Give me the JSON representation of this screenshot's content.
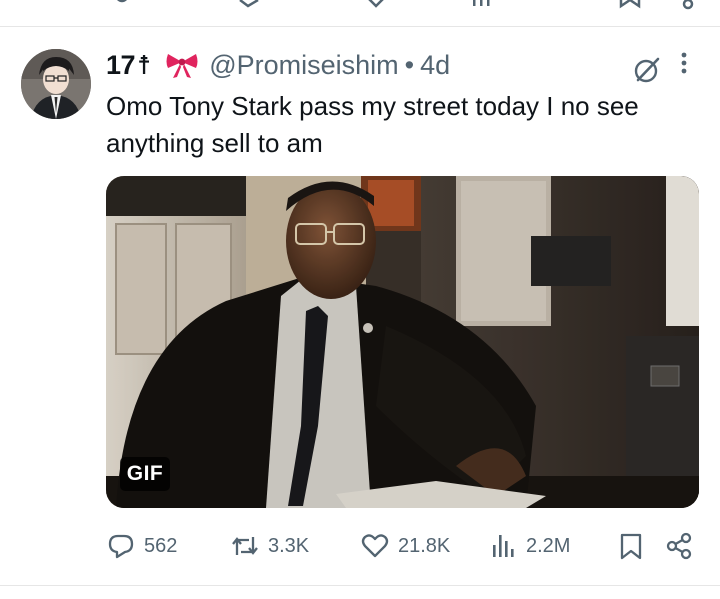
{
  "tweet": {
    "display_name": "17",
    "name_glyph": "☨",
    "handle": "@Promiseishim",
    "separator": "•",
    "time": "4d",
    "text": "Omo Tony Stark pass my street today I no see anything sell to am",
    "media": {
      "badge": "GIF"
    },
    "stats": {
      "replies": "562",
      "reposts": "3.3K",
      "likes": "21.8K",
      "views": "2.2M"
    }
  },
  "icons": {
    "bow": "ribbon-bow-icon",
    "grok": "grok-icon",
    "more": "more-vertical-icon",
    "reply": "reply-icon",
    "repost": "repost-icon",
    "like": "heart-icon",
    "views": "views-chart-icon",
    "bookmark": "bookmark-icon",
    "share": "share-icon"
  },
  "colors": {
    "text_primary": "#0f1419",
    "text_secondary": "#536471",
    "bow": "#e0245e",
    "divider": "#e6e6e6"
  }
}
